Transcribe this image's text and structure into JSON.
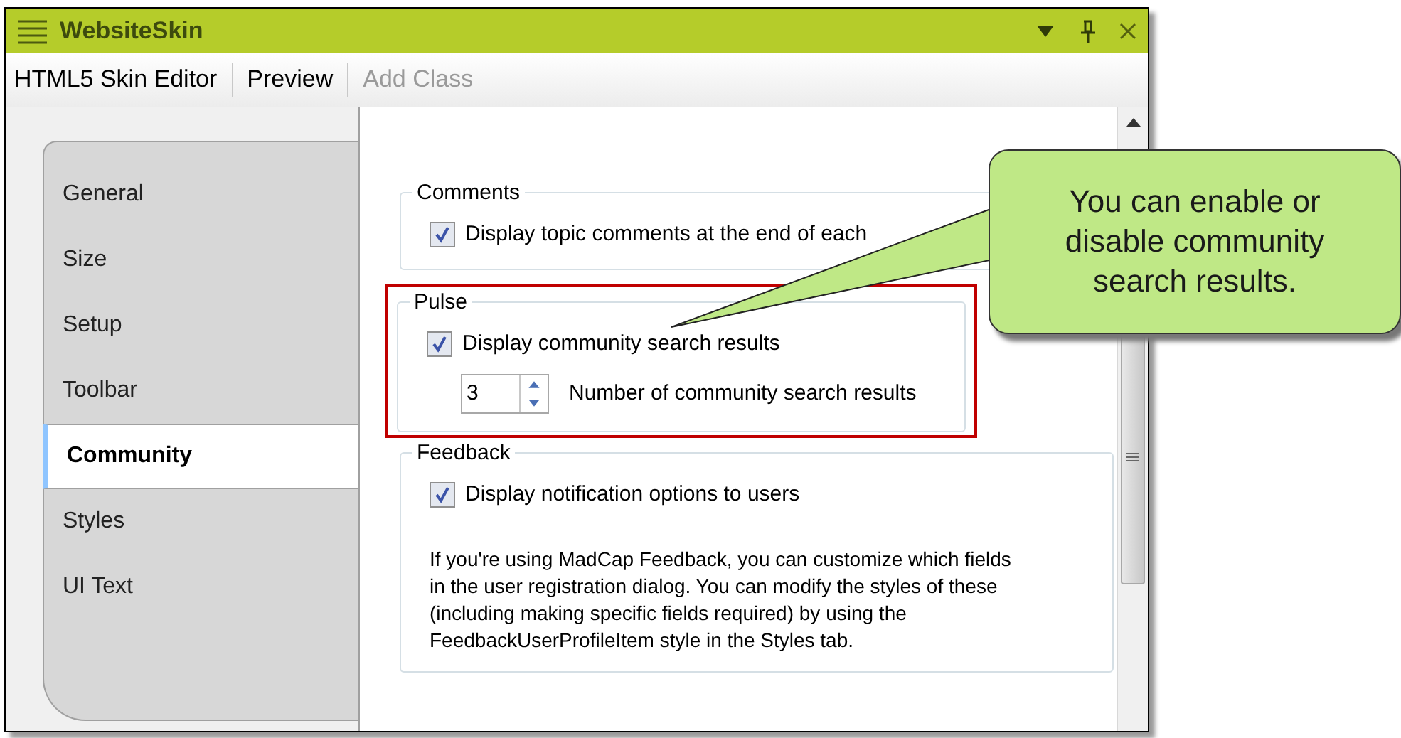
{
  "window": {
    "title": "WebsiteSkin"
  },
  "toolbar": [
    {
      "label": "HTML5 Skin Editor",
      "disabled": false
    },
    {
      "label": "Preview",
      "disabled": false
    },
    {
      "label": "Add Class",
      "disabled": true
    }
  ],
  "tabs": [
    {
      "label": "General",
      "selected": false
    },
    {
      "label": "Size",
      "selected": false
    },
    {
      "label": "Setup",
      "selected": false
    },
    {
      "label": "Toolbar",
      "selected": false
    },
    {
      "label": "Community",
      "selected": true
    },
    {
      "label": "Styles",
      "selected": false
    },
    {
      "label": "UI Text",
      "selected": false
    }
  ],
  "groups": [
    {
      "title": "Comments",
      "highlighted": false,
      "checkboxes": [
        {
          "label": "Display topic comments at the end of each",
          "checked": true
        }
      ]
    },
    {
      "title": "Pulse",
      "highlighted": true,
      "checkboxes": [
        {
          "label": "Display community search results",
          "checked": true
        }
      ],
      "spinner": {
        "value": "3",
        "label": "Number of community search results"
      }
    },
    {
      "title": "Feedback",
      "highlighted": false,
      "checkboxes": [
        {
          "label": "Display notification options to users",
          "checked": true
        }
      ],
      "paragraph_lines": [
        "If you're using MadCap Feedback, you can customize which fields",
        "in the user registration dialog. You can modify the styles of these",
        "(including making specific fields required) by using the",
        "FeedbackUserProfileItem style in the Styles tab."
      ]
    }
  ],
  "callout": {
    "text": "You can enable or disable community search results."
  }
}
